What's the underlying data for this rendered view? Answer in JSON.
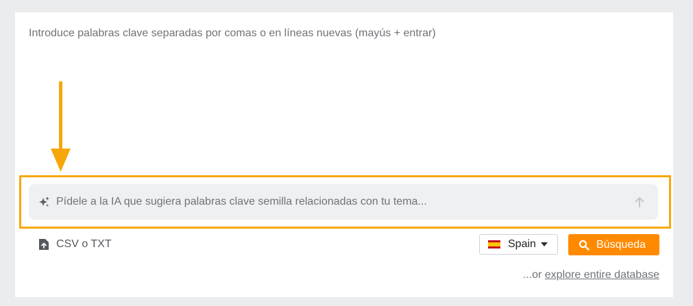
{
  "keywords": {
    "placeholder": "Introduce palabras clave separadas por comas o en líneas nuevas (mayús + entrar)"
  },
  "ai_prompt": {
    "placeholder": "Pídele a la IA que sugiera palabras clave semilla relacionadas con tu tema...",
    "spark_icon": "sparkles-icon",
    "send_icon": "arrow-up-icon"
  },
  "upload": {
    "label": "CSV o TXT",
    "icon": "file-upload-icon"
  },
  "country": {
    "label": "Spain",
    "flag": "spain-flag-icon"
  },
  "search_button": {
    "label": "Búsqueda",
    "icon": "search-icon"
  },
  "explore": {
    "prefix": "...or ",
    "link": "explore entire database"
  },
  "colors": {
    "accent": "#ff8a00",
    "highlight": "#f7a70c",
    "background": "#ebecee"
  }
}
